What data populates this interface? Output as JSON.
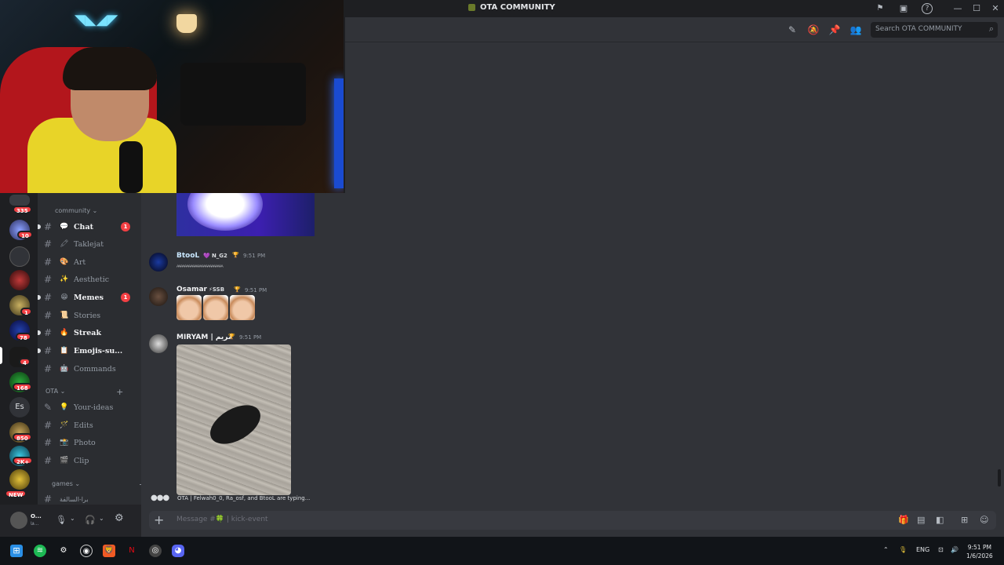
{
  "window": {
    "title": "OTA COMMUNITY",
    "min": "—",
    "max": "☐",
    "close": "✕"
  },
  "header": {
    "search_placeholder": "Search OTA COMMUNITY"
  },
  "server_badges": [
    "335",
    "10",
    "1",
    "78",
    "4",
    "168",
    "850",
    "2K+",
    "NEW"
  ],
  "server_text": {
    "es": "Es"
  },
  "channels": {
    "categories": [
      {
        "label": "community ⌄"
      },
      {
        "label": "OTA ⌄"
      },
      {
        "label": "games ⌄"
      }
    ],
    "items": [
      {
        "emoji": "💬",
        "name": "Chat",
        "unread": "1"
      },
      {
        "emoji": "🖍",
        "name": "Taklejat"
      },
      {
        "emoji": "🎨",
        "name": "Art"
      },
      {
        "emoji": "✨",
        "name": "Aesthetic"
      },
      {
        "emoji": "😁",
        "name": "Memes",
        "unread": "1"
      },
      {
        "emoji": "📜",
        "name": "Stories"
      },
      {
        "emoji": "🔥",
        "name": "Streak"
      },
      {
        "emoji": "📋",
        "name": "Emojis-su..."
      },
      {
        "emoji": "🤖",
        "name": "Commands"
      },
      {
        "emoji": "💡",
        "name": "Your-ideas"
      },
      {
        "emoji": "🪄",
        "name": "Edits"
      },
      {
        "emoji": "📸",
        "name": "Photo"
      },
      {
        "emoji": "🎬",
        "name": "Clip"
      },
      {
        "emoji": "",
        "name": "برا-السالفة"
      }
    ]
  },
  "user": {
    "name": "O...",
    "sub": "قا..."
  },
  "messages": [
    {
      "user": "BtooL",
      "tag": "N_G2",
      "time": "9:51 PM",
      "text": "ᴬᴬᴬᴬᴬᴬᴬᴬᴬᴬᴬᴬᴬᴬᴬᴬᴬᴬᴬᴬᴬᴬᴬᴬ"
    },
    {
      "user": "Osamar",
      "tag": "SSB",
      "time": "9:51 PM"
    },
    {
      "user": "MIRYAM | مريم",
      "time": "9:51 PM"
    }
  ],
  "typing": {
    "text": "OTA | Felwah0_0, Ra_osf, and BtooL are typing..."
  },
  "composer": {
    "placeholder": "Message #🍀 | kick-event"
  },
  "taskbar": {
    "lang": "ENG",
    "time": "9:51 PM",
    "date": "1/6/2026"
  }
}
